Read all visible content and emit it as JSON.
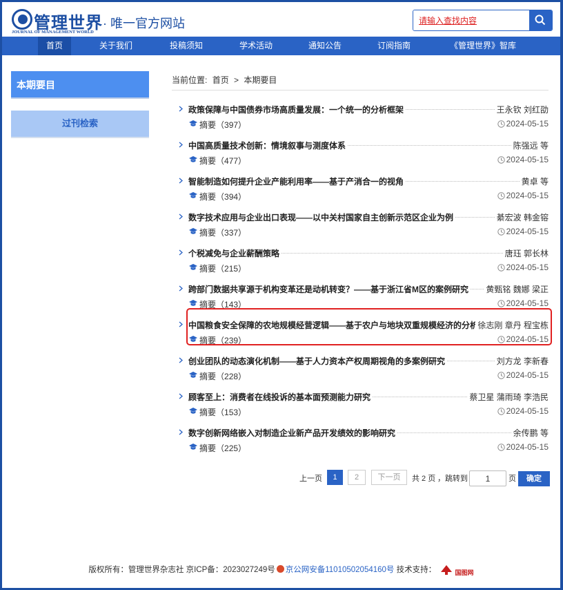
{
  "header": {
    "logo_text": "管理世界",
    "logo_subtitle": "JOURNAL OF MANAGEMENT WORLD",
    "slogan": "· 唯一官方网站",
    "search_placeholder": "请输入查找内容"
  },
  "nav": {
    "items": [
      {
        "label": "首页",
        "active": true
      },
      {
        "label": "关于我们",
        "active": false
      },
      {
        "label": "投稿须知",
        "active": false
      },
      {
        "label": "学术活动",
        "active": false
      },
      {
        "label": "通知公告",
        "active": false
      },
      {
        "label": "订阅指南",
        "active": false
      },
      {
        "label": "《管理世界》智库",
        "active": false
      }
    ]
  },
  "sidebar": {
    "current": "本期要目",
    "link": "过刊检索"
  },
  "breadcrumb": {
    "prefix": "当前位置:",
    "home": "首页",
    "sep": ">",
    "current": "本期要目"
  },
  "abstract_label": "摘要",
  "articles": [
    {
      "title": "政策保障与中国债券市场高质量发展：一个统一的分析框架",
      "authors": "王永钦 刘红劭",
      "abstract_count": "（397）",
      "date": "2024-05-15"
    },
    {
      "title": "中国高质量技术创新：情境叙事与测度体系",
      "authors": "陈强远 等",
      "abstract_count": "（477）",
      "date": "2024-05-15"
    },
    {
      "title": "智能制造如何提升企业产能利用率——基于产消合一的视角",
      "authors": "黄卓 等",
      "abstract_count": "（394）",
      "date": "2024-05-15"
    },
    {
      "title": "数字技术应用与企业出口表现——以中关村国家自主创新示范区企业为例",
      "authors": "綦宏波 韩金镕",
      "abstract_count": "（337）",
      "date": "2024-05-15"
    },
    {
      "title": "个税减免与企业薪酬策略",
      "authors": "唐珏 郭长林",
      "abstract_count": "（215）",
      "date": "2024-05-15"
    },
    {
      "title": "跨部门数据共享源于机构变革还是动机转变？——基于浙江省M区的案例研究",
      "authors": "黄甄铭 魏娜 梁正",
      "abstract_count": "（143）",
      "date": "2024-05-15"
    },
    {
      "title": "中国粮食安全保障的农地规模经营逻辑——基于农户与地块双重规模经济的分析视角",
      "authors": "徐志刚 章丹 程宝栋",
      "abstract_count": "（239）",
      "date": "2024-05-15"
    },
    {
      "title": "创业团队的动态演化机制——基于人力资本产权周期视角的多案例研究",
      "authors": "刘方龙 李新春",
      "abstract_count": "（228）",
      "date": "2024-05-15"
    },
    {
      "title": "顾客至上：消费者在线投诉的基本面预测能力研究",
      "authors": "蔡卫星 蒲雨琦 李浩民",
      "abstract_count": "（153）",
      "date": "2024-05-15"
    },
    {
      "title": "数字创新网络嵌入对制造企业新产品开发绩效的影响研究",
      "authors": "余传鹏 等",
      "abstract_count": "（225）",
      "date": "2024-05-15"
    }
  ],
  "pagination": {
    "prev": "上一页",
    "page1": "1",
    "page2": "2",
    "next": "下一页",
    "total": "共 2 页",
    "jump_to": "，跳转到",
    "page_value": "1",
    "page_unit": "页",
    "confirm": "确定"
  },
  "footer": {
    "copyright": "版权所有：管理世界杂志社 京ICP备：2023027249号",
    "police": "京公网安备11010502054160号",
    "support": "技术支持：",
    "support_brand": "国图网"
  },
  "colors": {
    "brand_blue": "#2a63c5",
    "highlight_red": "#e02020"
  }
}
